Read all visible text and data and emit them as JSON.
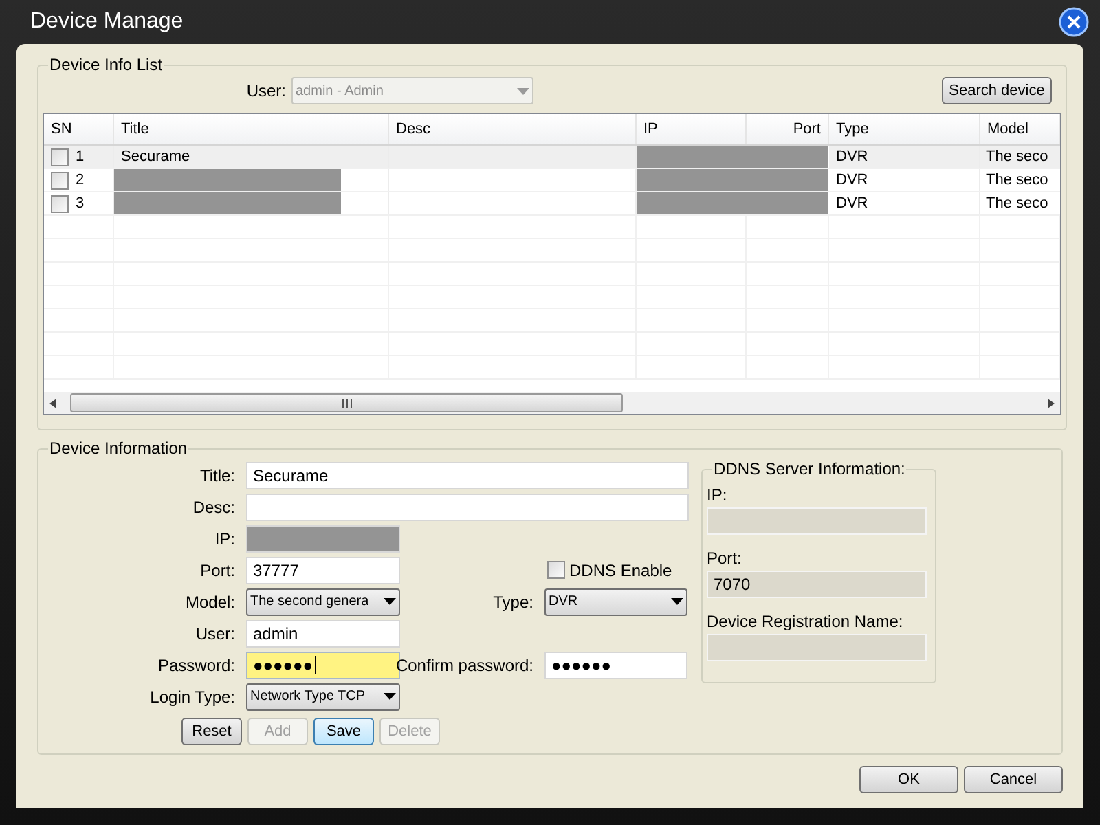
{
  "window": {
    "title": "Device Manage"
  },
  "device_list": {
    "legend": "Device Info List",
    "user_label": "User:",
    "user_value": "admin - Admin",
    "user_disabled": true,
    "search_button": "Search device",
    "columns": [
      "SN",
      "Title",
      "Desc",
      "IP",
      "Port",
      "Type",
      "Model"
    ],
    "rows": [
      {
        "selected": true,
        "checked": false,
        "sn": "1",
        "title": "Securame",
        "title_redacted": false,
        "address_redacted": true,
        "type": "DVR",
        "model": "The seco"
      },
      {
        "selected": false,
        "checked": false,
        "sn": "2",
        "title_redacted": true,
        "address_redacted": true,
        "type": "DVR",
        "model": "The seco"
      },
      {
        "selected": false,
        "checked": false,
        "sn": "3",
        "title_redacted": true,
        "address_redacted": true,
        "type": "DVR",
        "model": "The seco"
      }
    ]
  },
  "device_info": {
    "legend": "Device Information",
    "title": {
      "label": "Title:",
      "value": "Securame"
    },
    "desc": {
      "label": "Desc:"
    },
    "ip": {
      "label": "IP:",
      "redacted": true
    },
    "port": {
      "label": "Port:",
      "value": "37777"
    },
    "ddns_enable": {
      "label": "DDNS Enable",
      "checked": false
    },
    "model": {
      "label": "Model:",
      "value": "The second genera"
    },
    "type": {
      "label": "Type:",
      "value": "DVR"
    },
    "user": {
      "label": "User:",
      "value": "admin"
    },
    "password": {
      "label": "Password:",
      "value": "●●●●●●",
      "focused": true
    },
    "confirm_password": {
      "label": "Confirm password:",
      "value": "●●●●●●"
    },
    "login_type": {
      "label": "Login Type:",
      "value": "Network Type TCP"
    },
    "buttons": [
      {
        "label": "Reset",
        "disabled": false,
        "focused": false
      },
      {
        "label": "Add",
        "disabled": true,
        "focused": false
      },
      {
        "label": "Save",
        "disabled": false,
        "focused": true
      },
      {
        "label": "Delete",
        "disabled": true,
        "focused": false
      }
    ]
  },
  "ddns": {
    "legend": "DDNS Server Information:",
    "ip": {
      "label": "IP:"
    },
    "port": {
      "label": "Port:",
      "value": "7070"
    },
    "registration_name": {
      "label": "Device Registration Name:"
    }
  },
  "footer_buttons": [
    "OK",
    "Cancel"
  ]
}
